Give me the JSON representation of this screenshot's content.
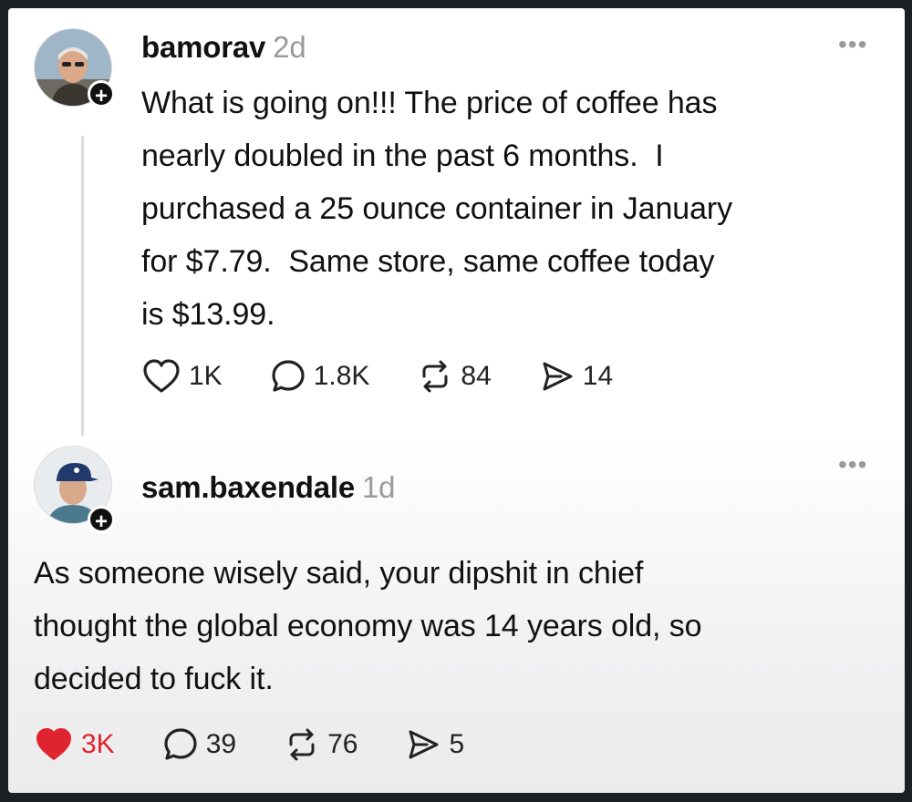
{
  "post": {
    "username": "bamorav",
    "age": "2d",
    "more": "•••",
    "text": "What is going on!!! The price of coffee has\nnearly doubled in the past 6 months.  I\npurchased a 25 ounce container in January\nfor $7.79.  Same store, same coffee today\nis $13.99.",
    "likes": "1K",
    "comments": "1.8K",
    "reposts": "84",
    "shares": "14",
    "liked": false
  },
  "reply": {
    "username": "sam.baxendale",
    "age": "1d",
    "more": "•••",
    "text": "As someone wisely said, your dipshit in chief\nthought the global economy was 14 years old, so\ndecided to fuck it.",
    "likes": "3K",
    "comments": "39",
    "reposts": "76",
    "shares": "5",
    "liked": true
  },
  "follow_symbol": "+",
  "colors": {
    "like_active": "#e0242f",
    "muted": "#9a9a9a",
    "text": "#111111"
  },
  "icons": {
    "like": "heart-icon",
    "comment": "comment-bubble-icon",
    "repost": "repost-icon",
    "share": "send-icon"
  }
}
